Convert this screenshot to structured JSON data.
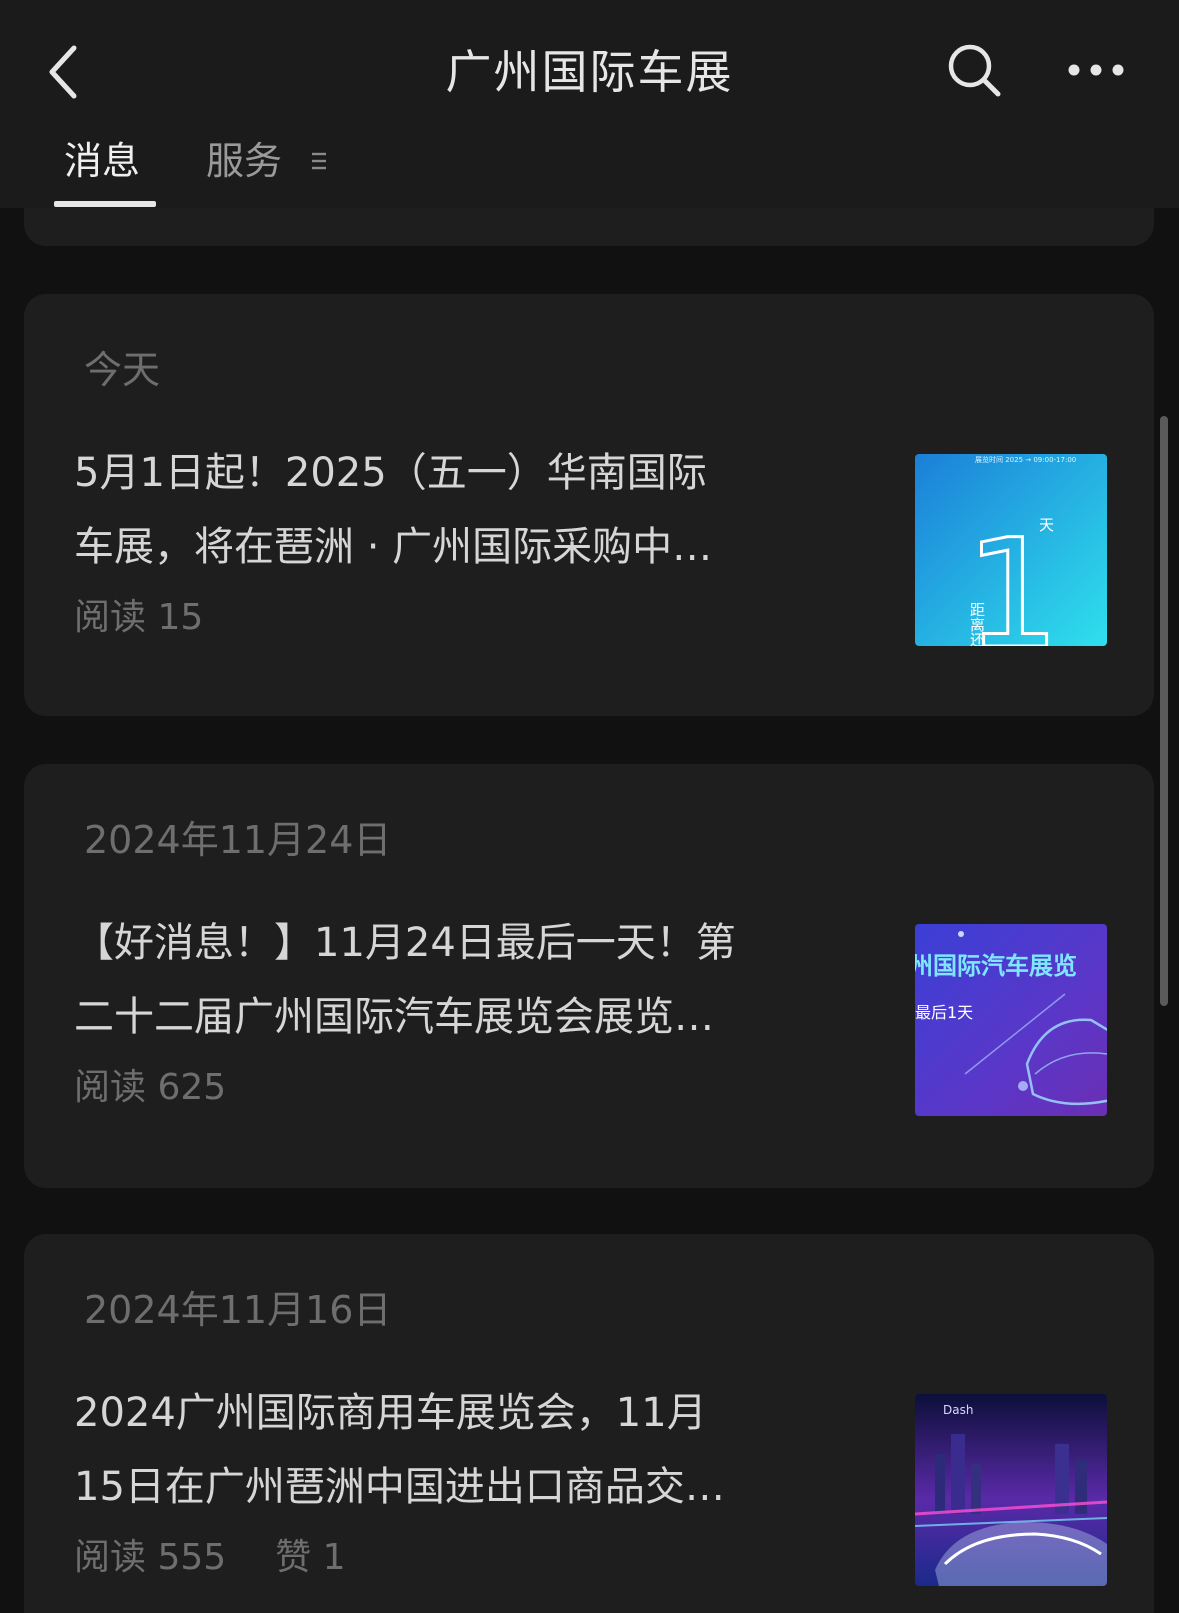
{
  "header": {
    "title": "广州国际车展",
    "back_icon": "chevron-left-icon",
    "search_icon": "search-icon",
    "more_icon": "more-horizontal-icon"
  },
  "tabs": [
    {
      "label": "消息",
      "active": true
    },
    {
      "label": "服务",
      "active": false,
      "icon": "menu-lines-icon"
    }
  ],
  "articles": [
    {
      "date": "今天",
      "title_lines": [
        "5月1日起！2025（五一）华南国际",
        "车展，将在琶洲 · 广州国际采购中…"
      ],
      "reads_label": "阅读",
      "reads": "15",
      "thumb": {
        "numeral": "1",
        "unit": "天",
        "vertical_text": "距离还",
        "top_text": "展览时间 2025 → 09:00-17:00"
      }
    },
    {
      "date": "2024年11月24日",
      "title_lines": [
        "【好消息！】11月24日最后一天！第",
        "二十二届广州国际汽车展览会展览…"
      ],
      "reads_label": "阅读",
      "reads": "625",
      "thumb": {
        "line1": "州国际汽车展览",
        "line2": "最后1天"
      }
    },
    {
      "date": "2024年11月16日",
      "title_lines": [
        "2024广州国际商用车展览会，11月",
        "15日在广州琶洲中国进出口商品交…"
      ],
      "reads_label": "阅读",
      "reads": "555",
      "likes_label": "赞",
      "likes": "1",
      "thumb": {
        "logo": "Dash"
      }
    }
  ],
  "colors": {
    "background": "#111111",
    "header": "#1b1b1b",
    "card": "#1e1e1e",
    "primary_text": "#d6d6d6",
    "secondary_text": "#6e6e6e"
  }
}
